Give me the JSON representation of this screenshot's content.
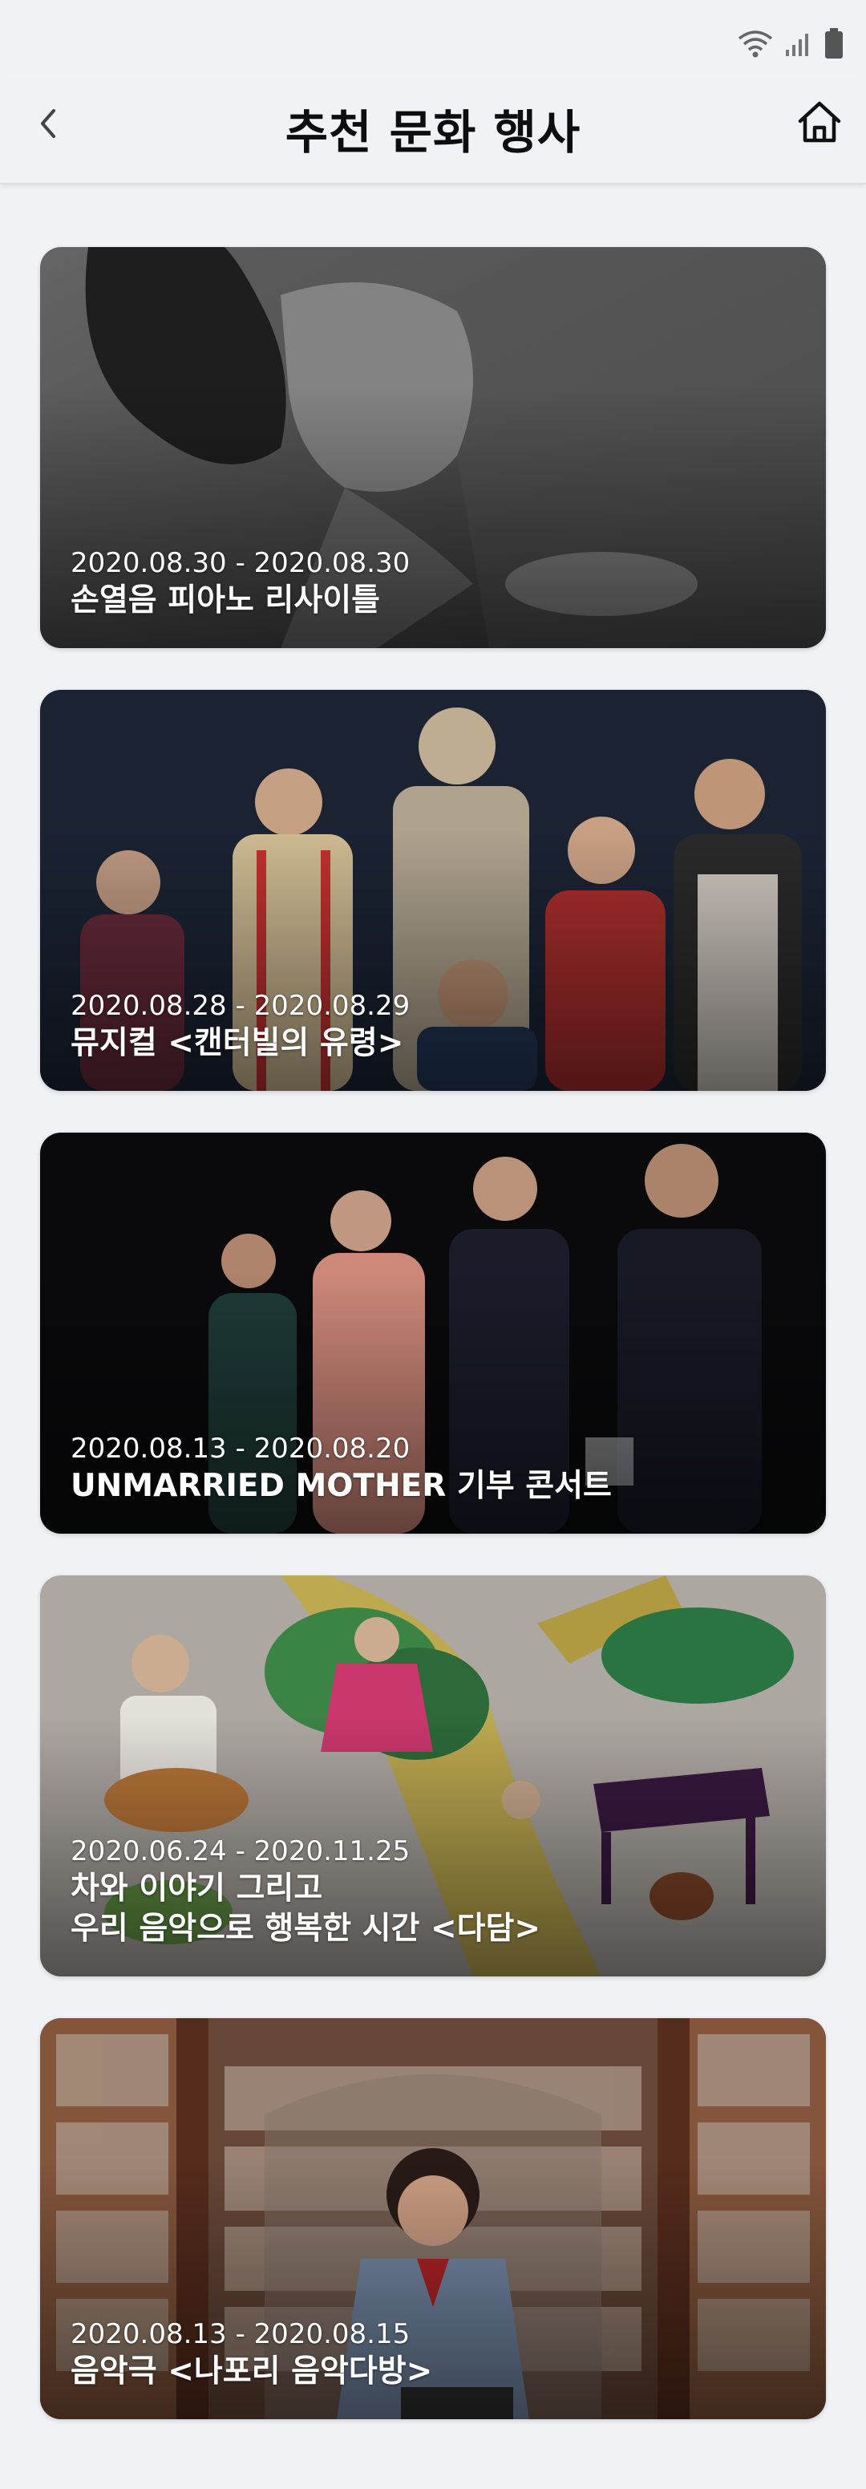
{
  "header": {
    "title": "추천 문화 행사",
    "back_icon": "chevron-left-icon",
    "home_icon": "home-icon"
  },
  "status_bar": {
    "icons": [
      "wifi-icon",
      "signal-icon",
      "battery-icon"
    ]
  },
  "events": [
    {
      "date": "2020.08.30 - 2020.08.30",
      "title": "손열음 피아노 리사이틀"
    },
    {
      "date": "2020.08.28 - 2020.08.29",
      "title": "뮤지컬 <캔터빌의 유령>"
    },
    {
      "date": "2020.08.13 - 2020.08.20",
      "title": "UNMARRIED MOTHER 기부 콘서트"
    },
    {
      "date": "2020.06.24 - 2020.11.25",
      "title": "차와 이야기 그리고\n우리 음악으로 행복한 시간 <다담>"
    },
    {
      "date": "2020.08.13 - 2020.08.15",
      "title": "음악극 <나포리 음악다방>"
    }
  ],
  "colors": {
    "background": "#f1f2f6",
    "title_text": "#0e0e0e",
    "card_text": "#ffffff"
  }
}
